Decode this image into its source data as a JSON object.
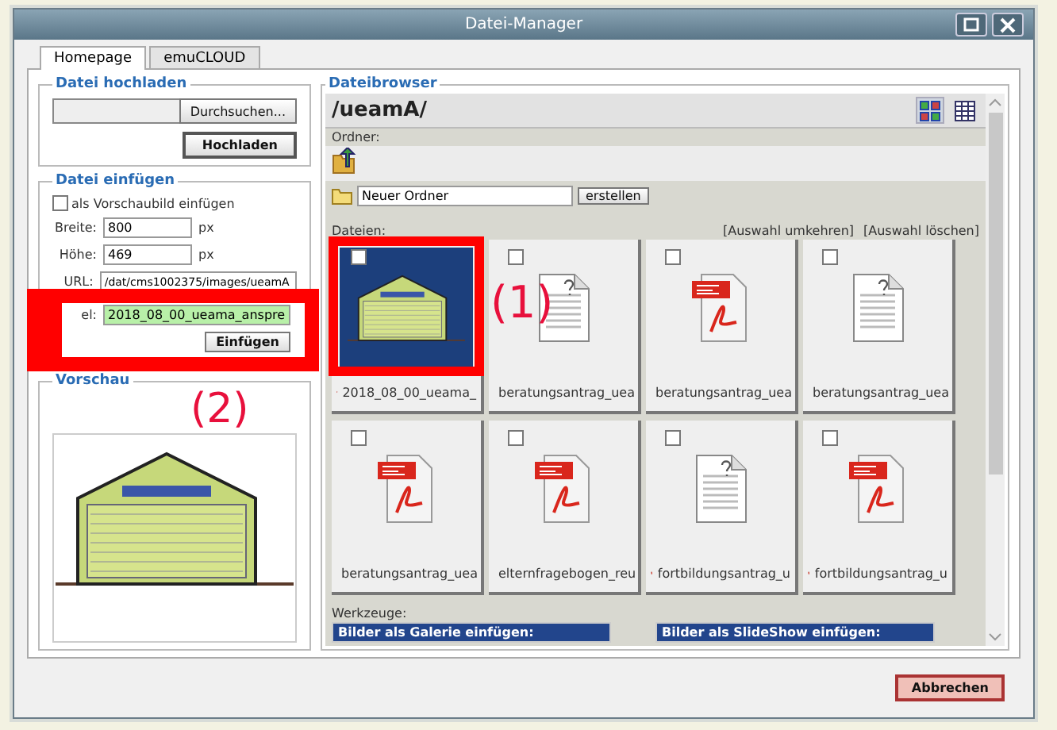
{
  "window": {
    "title": "Datei-Manager"
  },
  "tabs": [
    {
      "label": "Homepage",
      "selected": true
    },
    {
      "label": "emuCLOUD",
      "selected": false
    }
  ],
  "upload": {
    "legend": "Datei hochladen",
    "browse_button": "Durchsuchen...",
    "upload_button": "Hochladen"
  },
  "insert": {
    "legend": "Datei einfügen",
    "thumbnail_option": {
      "label": "als Vorschaubild einfügen",
      "checked": false
    },
    "width_label": "Breite:",
    "width_value": "800",
    "width_unit": "px",
    "height_label": "Höhe:",
    "height_value": "469",
    "height_unit": "px",
    "url_label": "URL:",
    "url_value": "/dat/cms1002375/images/ueamA",
    "title_label": "el:",
    "title_value": "2018_08_00_ueama_anspre",
    "insert_button": "Einfügen",
    "highlighted": true
  },
  "preview": {
    "legend": "Vorschau"
  },
  "browser": {
    "legend": "Dateibrowser",
    "path": "/ueamA/",
    "folders_label": "Ordner:",
    "new_folder_value": "Neuer Ordner",
    "create_button": "erstellen",
    "files_label": "Dateien:",
    "invert_link": "[Auswahl umkehren]",
    "clear_link": "[Auswahl löschen]",
    "files": [
      {
        "kind": "image",
        "name": "2018_08_00_ueama_",
        "checked": false,
        "highlighted": true
      },
      {
        "kind": "unknown",
        "name": "beratungsantrag_uea",
        "checked": false,
        "highlighted": false
      },
      {
        "kind": "pdf",
        "name": "beratungsantrag_uea",
        "checked": false,
        "highlighted": false
      },
      {
        "kind": "unknown",
        "name": "beratungsantrag_uea",
        "checked": false,
        "highlighted": false
      },
      {
        "kind": "pdf",
        "name": "beratungsantrag_uea",
        "checked": false,
        "highlighted": false
      },
      {
        "kind": "pdf",
        "name": "elternfragebogen_reu",
        "checked": false,
        "highlighted": false
      },
      {
        "kind": "unknown",
        "name": "fortbildungsantrag_u",
        "checked": false,
        "highlighted": false
      },
      {
        "kind": "pdf",
        "name": "fortbildungsantrag_u",
        "checked": false,
        "highlighted": false
      }
    ],
    "tools_label": "Werkzeuge:",
    "tools": [
      "Bilder als Galerie einfügen:",
      "Bilder als SlideShow einfügen:"
    ]
  },
  "annotations": [
    "(1)",
    "(2)"
  ],
  "cancel_button": "Abbrechen"
}
